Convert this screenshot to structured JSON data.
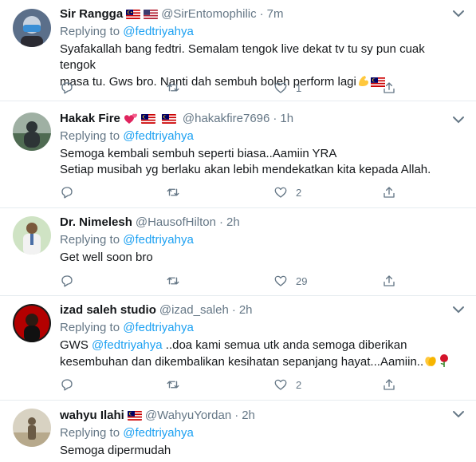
{
  "tweets": [
    {
      "name": "Sir Rangga",
      "handle": "@SirEntomophilic",
      "time": "7m",
      "replying_label": "Replying to",
      "replying_to": "@fedtriyahya",
      "lines": [
        "Syafakallah bang fedtri. Semalam tengok live dekat tv tu sy pun cuak tengok",
        "masa tu. Gws bro. Nanti dah sembuh boleh perform lagi"
      ],
      "likes": "1",
      "avatar_colors": [
        "#5b6f8a",
        "#c9d3e0"
      ],
      "badges": [
        "flag-malaysia",
        "flag-usa"
      ],
      "emojis": [
        "flexed-biceps",
        "flag-malaysia"
      ]
    },
    {
      "name": "Hakak Fire",
      "handle": "@hakakfire7696",
      "time": "1h",
      "replying_label": "Replying to",
      "replying_to": "@fedtriyahya",
      "lines": [
        "Semoga kembali sembuh seperti biasa..Aamiin YRA",
        "Setiap musibah yg berlaku akan lebih mendekatkan kita kepada Allah."
      ],
      "likes": "2",
      "avatar_colors": [
        "#2d3436",
        "#9fb0a3"
      ],
      "badges": [
        "two-hearts",
        "flag-malaysia",
        "flag-malaysia"
      ]
    },
    {
      "name": "Dr. Nimelesh",
      "handle": "@HausofHilton",
      "time": "2h",
      "replying_label": "Replying to",
      "replying_to": "@fedtriyahya",
      "lines": [
        "Get well soon bro"
      ],
      "likes": "29",
      "avatar_colors": [
        "#cfe3c4",
        "#f2f2f2"
      ]
    },
    {
      "name": "izad saleh studio",
      "handle": "@izad_saleh",
      "time": "2h",
      "replying_label": "Replying to",
      "replying_to": "@fedtriyahya",
      "body_prefix": "GWS ",
      "body_mention": "@fedtriyahya",
      "body_line1_rest": " ..doa kami semua utk anda semoga diberikan",
      "body_line2": "kesembuhan dan dikembalikan kesihatan sepanjang hayat...Aamiin..",
      "likes": "2",
      "avatar_colors": [
        "#b30000",
        "#1a1a1a"
      ],
      "emojis": [
        "clapping-hands",
        "rose"
      ]
    },
    {
      "name": "wahyu Ilahi",
      "handle": "@WahyuYordan",
      "time": "2h",
      "replying_label": "Replying to",
      "replying_to": "@fedtriyahya",
      "lines": [
        "Semoga dipermudah"
      ],
      "avatar_colors": [
        "#d8d2c2",
        "#6b5b45"
      ],
      "badges": [
        "flag-malaysia"
      ]
    }
  ],
  "icons": {
    "reply": "reply-icon",
    "retweet": "retweet-icon",
    "like": "heart-icon",
    "share": "share-icon",
    "more": "chevron-down-icon"
  },
  "colors": {
    "accent": "#1da1f2",
    "secondary_text": "#657786",
    "divider": "#e6ecf0"
  }
}
